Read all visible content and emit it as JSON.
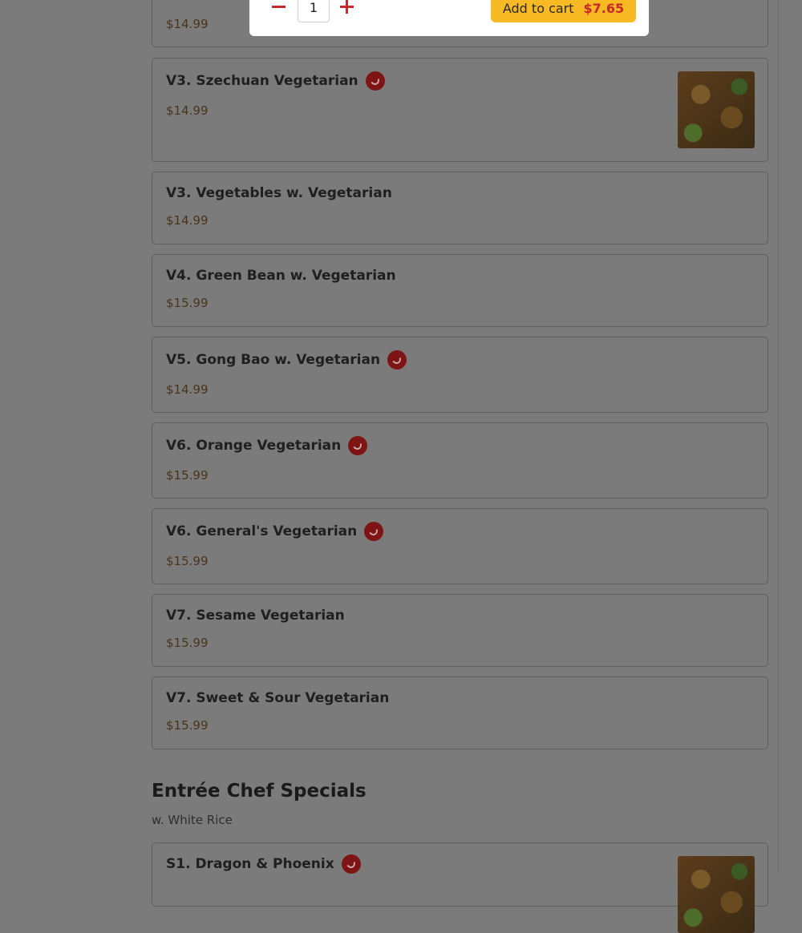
{
  "top_card": {
    "price": "$14.99"
  },
  "modal": {
    "quantity": "1",
    "add_label": "Add to cart",
    "add_price": "$7.65"
  },
  "items": [
    {
      "name": "V3. Szechuan Vegetarian",
      "price": "$14.99",
      "spicy": true,
      "image": true
    },
    {
      "name": "V3. Vegetables w. Vegetarian",
      "price": "$14.99",
      "spicy": false,
      "image": false
    },
    {
      "name": "V4. Green Bean w. Vegetarian",
      "price": "$15.99",
      "spicy": false,
      "image": false
    },
    {
      "name": "V5. Gong Bao w. Vegetarian",
      "price": "$14.99",
      "spicy": true,
      "image": false
    },
    {
      "name": "V6. Orange Vegetarian",
      "price": "$15.99",
      "spicy": true,
      "image": false
    },
    {
      "name": "V6. General's Vegetarian",
      "price": "$15.99",
      "spicy": true,
      "image": false
    },
    {
      "name": "V7. Sesame Vegetarian",
      "price": "$15.99",
      "spicy": false,
      "image": false
    },
    {
      "name": "V7. Sweet & Sour Vegetarian",
      "price": "$15.99",
      "spicy": false,
      "image": false
    }
  ],
  "section": {
    "title": "Entrée Chef Specials",
    "subtitle": "w. White Rice"
  },
  "section_items": [
    {
      "name": "S1. Dragon & Phoenix",
      "spicy": true,
      "image": true
    }
  ],
  "icons": {
    "spicy": "chili-pepper-icon",
    "minus": "minus-icon",
    "plus": "plus-icon"
  },
  "colors": {
    "accent": "#c8282b",
    "cart_button": "#f7b924",
    "spicy_badge": "#7e1414"
  }
}
